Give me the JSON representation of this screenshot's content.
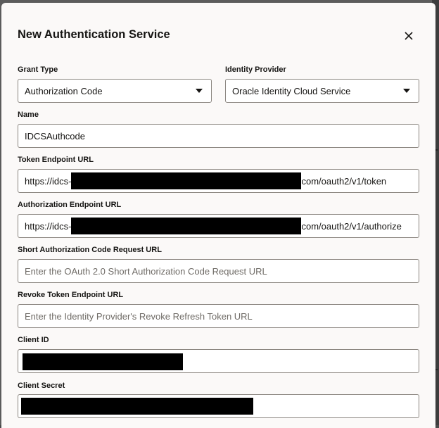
{
  "dialog": {
    "title": "New Authentication Service",
    "close_label": "Close"
  },
  "fields": {
    "grant_type": {
      "label": "Grant Type",
      "value": "Authorization Code"
    },
    "identity_provider": {
      "label": "Identity Provider",
      "value": "Oracle Identity Cloud Service"
    },
    "name": {
      "label": "Name",
      "value": "IDCSAuthcode"
    },
    "token_endpoint": {
      "label": "Token Endpoint URL",
      "value_prefix": "https://idcs-",
      "value_suffix": "com/oauth2/v1/token"
    },
    "authorization_endpoint": {
      "label": "Authorization Endpoint URL",
      "value_prefix": "https://idcs-",
      "value_suffix": "com/oauth2/v1/authorize"
    },
    "short_auth_code_url": {
      "label": "Short Authorization Code Request URL",
      "placeholder": "Enter the OAuth 2.0 Short Authorization Code Request URL"
    },
    "revoke_token_endpoint": {
      "label": "Revoke Token Endpoint URL",
      "placeholder": "Enter the Identity Provider's Revoke Refresh Token URL"
    },
    "client_id": {
      "label": "Client ID"
    },
    "client_secret": {
      "label": "Client Secret"
    }
  },
  "colors": {
    "dialog_bg": "#fbf9f8",
    "text": "#161513",
    "border": "#8b8680",
    "placeholder": "#6f6b66",
    "redaction": "#000000"
  }
}
